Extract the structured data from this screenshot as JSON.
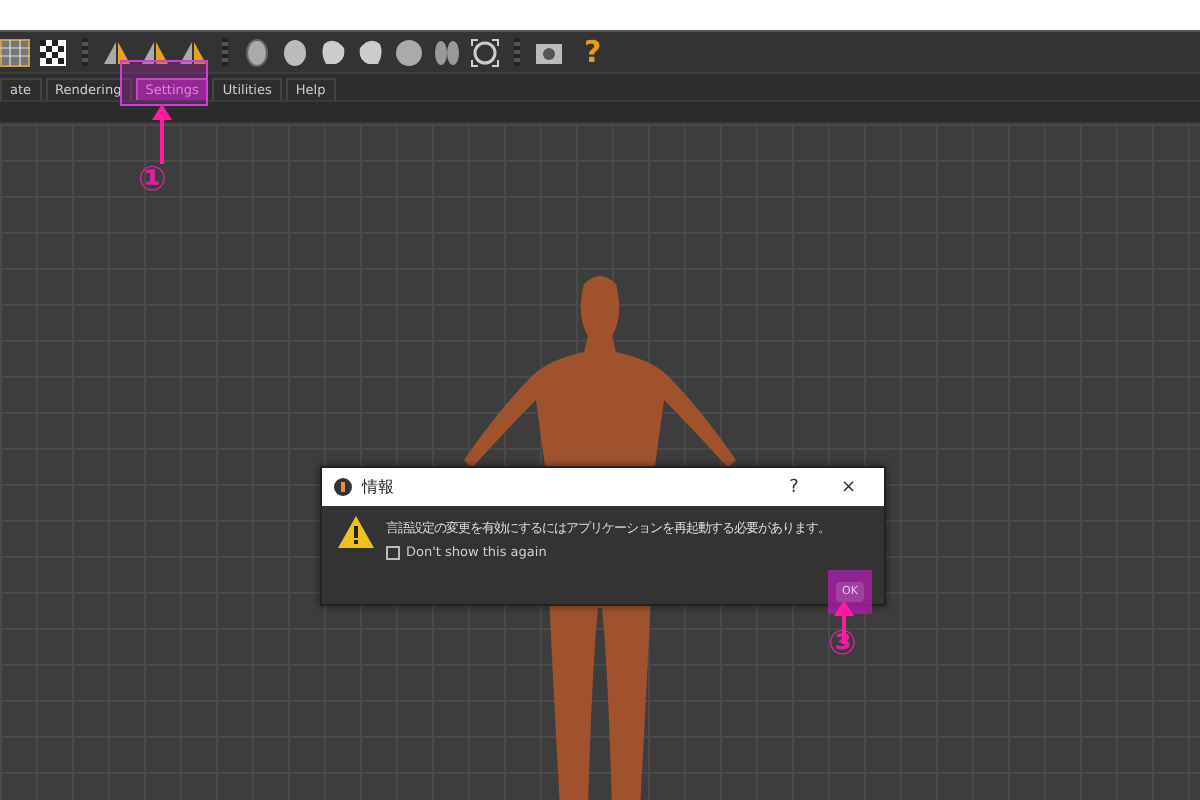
{
  "toolbar": {
    "help_glyph": "?"
  },
  "menu": [
    {
      "label": "ate",
      "selected": false
    },
    {
      "label": "Rendering",
      "selected": false
    },
    {
      "label": "Settings",
      "selected": true
    },
    {
      "label": "Utilities",
      "selected": false
    },
    {
      "label": "Help",
      "selected": false
    }
  ],
  "annotations": [
    {
      "label": "①"
    },
    {
      "label": "③"
    }
  ],
  "dialog": {
    "title": "情報",
    "help": "?",
    "close": "×",
    "message": "言語設定の変更を有効にするにはアプリケーションを再起動する必要があります。",
    "checkbox": {
      "label": "Don't show this again",
      "checked": false
    },
    "ok": "OK"
  }
}
